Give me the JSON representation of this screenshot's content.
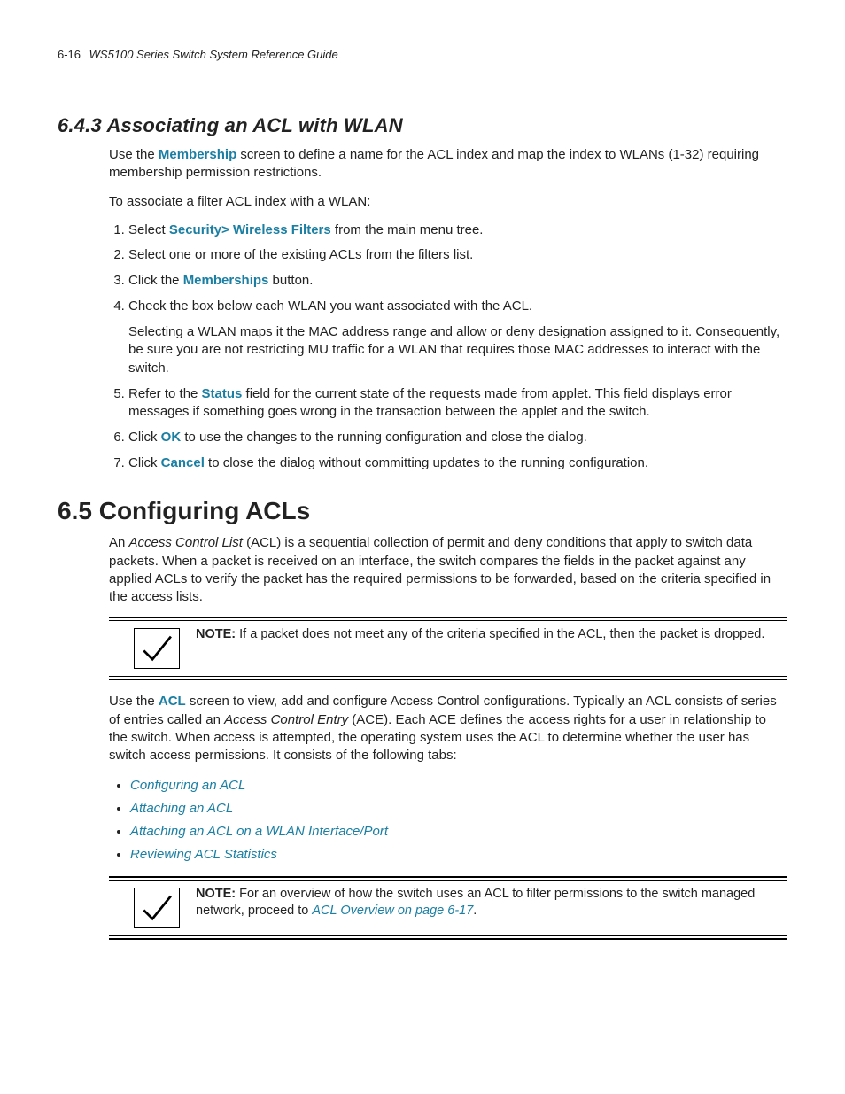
{
  "header": {
    "page_number": "6-16",
    "doc_title": "WS5100 Series Switch System Reference Guide"
  },
  "sec_643": {
    "number": "6.4.3",
    "title": "Associating an ACL with WLAN",
    "intro_pre": "Use the ",
    "intro_bold": "Membership",
    "intro_post": " screen to define a name for the ACL index and map the index to WLANs (1-32) requiring membership permission restrictions.",
    "lead": "To associate a filter ACL index with a WLAN:",
    "step1_pre": "Select ",
    "step1_bold": "Security> Wireless Filters",
    "step1_post": " from the main menu tree.",
    "step2": "Select one or more of the existing ACLs from the filters list.",
    "step3_pre": "Click the ",
    "step3_bold": "Memberships",
    "step3_post": " button.",
    "step4": "Check the box below each WLAN you want associated with the ACL.",
    "step4_para": "Selecting a WLAN maps it the MAC address range and allow or deny designation assigned to it. Consequently, be sure you are not restricting MU traffic for a WLAN that requires those MAC addresses to interact with the switch.",
    "step5_pre": "Refer to the ",
    "step5_bold": "Status",
    "step5_post": " field for the current state of the requests made from applet. This field displays error messages if something goes wrong in the transaction between the applet and the switch.",
    "step6_pre": "Click ",
    "step6_bold": "OK",
    "step6_post": " to use the changes to the running configuration and close the dialog.",
    "step7_pre": "Click ",
    "step7_bold": "Cancel",
    "step7_post": " to close the dialog without committing updates to the running configuration."
  },
  "sec_65": {
    "number": "6.5",
    "title": "Configuring ACLs",
    "p1_pre": "An ",
    "p1_ital": "Access Control List",
    "p1_post": " (ACL) is a sequential collection of permit and deny conditions that apply to switch data packets. When a packet is received on an interface, the switch compares the fields in the packet against any applied ACLs to verify the packet has the required permissions to be forwarded, based on the criteria specified in the access lists.",
    "note1_label": "NOTE:",
    "note1_text": " If a packet does not meet any of the criteria specified in the ACL, then the packet is dropped.",
    "p2_pre": "Use the ",
    "p2_bold": "ACL",
    "p2_mid": " screen to view, add and configure Access Control configurations. Typically an ACL consists of series of entries called an ",
    "p2_ital": "Access Control Entry",
    "p2_post": " (ACE). Each ACE defines the access rights for a user in relationship to the switch. When access is attempted, the operating system uses the ACL to determine whether the user has switch access permissions. It consists of the following tabs:",
    "bullets": {
      "b1": "Configuring an ACL",
      "b2": "Attaching an ACL",
      "b3": "Attaching an ACL on a WLAN Interface/Port",
      "b4": "Reviewing ACL Statistics"
    },
    "note2_label": "NOTE:",
    "note2_text_pre": " For an overview of how the switch uses an ACL to filter permissions to the switch managed network, proceed to ",
    "note2_link": "ACL Overview on page 6-17",
    "note2_text_post": "."
  }
}
